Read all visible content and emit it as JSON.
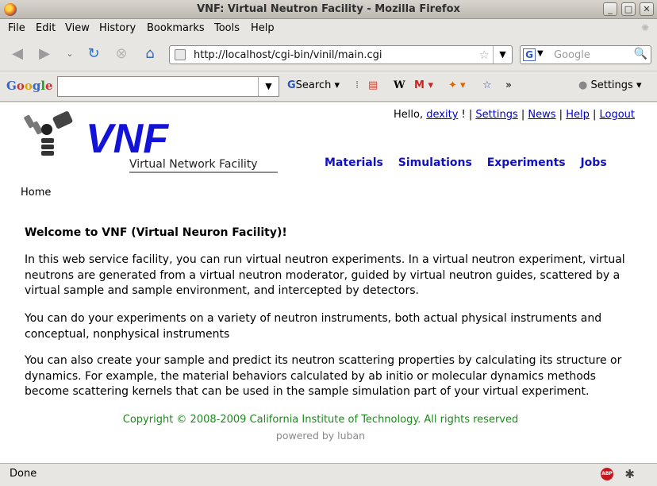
{
  "window": {
    "title": "VNF: Virtual Neutron Facility - Mozilla Firefox"
  },
  "menu": [
    "File",
    "Edit",
    "View",
    "History",
    "Bookmarks",
    "Tools",
    "Help"
  ],
  "nav": {
    "url": "http://localhost/cgi-bin/vinil/main.cgi",
    "search_placeholder": "Google"
  },
  "google_toolbar": {
    "logo": "Google",
    "search_label": "Search",
    "wiki_label": "W",
    "gmail_label": "M",
    "more_label": "»",
    "settings_label": "Settings"
  },
  "page": {
    "logo_text": "VNF",
    "logo_subtitle": "Virtual Network Facility",
    "greeting": "Hello,",
    "username": "dexity",
    "greeting_suffix": "!",
    "user_links": [
      "Settings",
      "News",
      "Help",
      "Logout"
    ],
    "nav_links": [
      "Materials",
      "Simulations",
      "Experiments",
      "Jobs"
    ],
    "breadcrumb": "Home",
    "welcome": "Welcome to VNF (Virtual Neuron Facility)!",
    "paragraphs": [
      "In this web service facility, you can run virtual neutron experiments. In a virtual neutron experiment, virtual neutrons are generated from a virtual neutron moderator, guided by virtual neutron guides, scattered by a virtual sample and sample environment, and intercepted by detectors.",
      "You can do your experiments on a variety of neutron instruments, both actual physical instruments and conceptual, nonphysical instruments",
      "You can also create your sample and predict its neutron scattering properties by calculating its structure or dynamics. For example, the material behaviors calculated by ab initio or molecular dynamics methods become scattering kernels that can be used in the sample simulation part of your virtual experiment."
    ],
    "copyright": "Copyright © 2008-2009 California Institute of Technology. All rights reserved",
    "powered_by": "powered by luban"
  },
  "statusbar": {
    "status": "Done",
    "abp_label": "ABP"
  },
  "colors": {
    "link": "#0000cc",
    "nav": "#1010c8",
    "copyright": "#1a8a1a"
  }
}
